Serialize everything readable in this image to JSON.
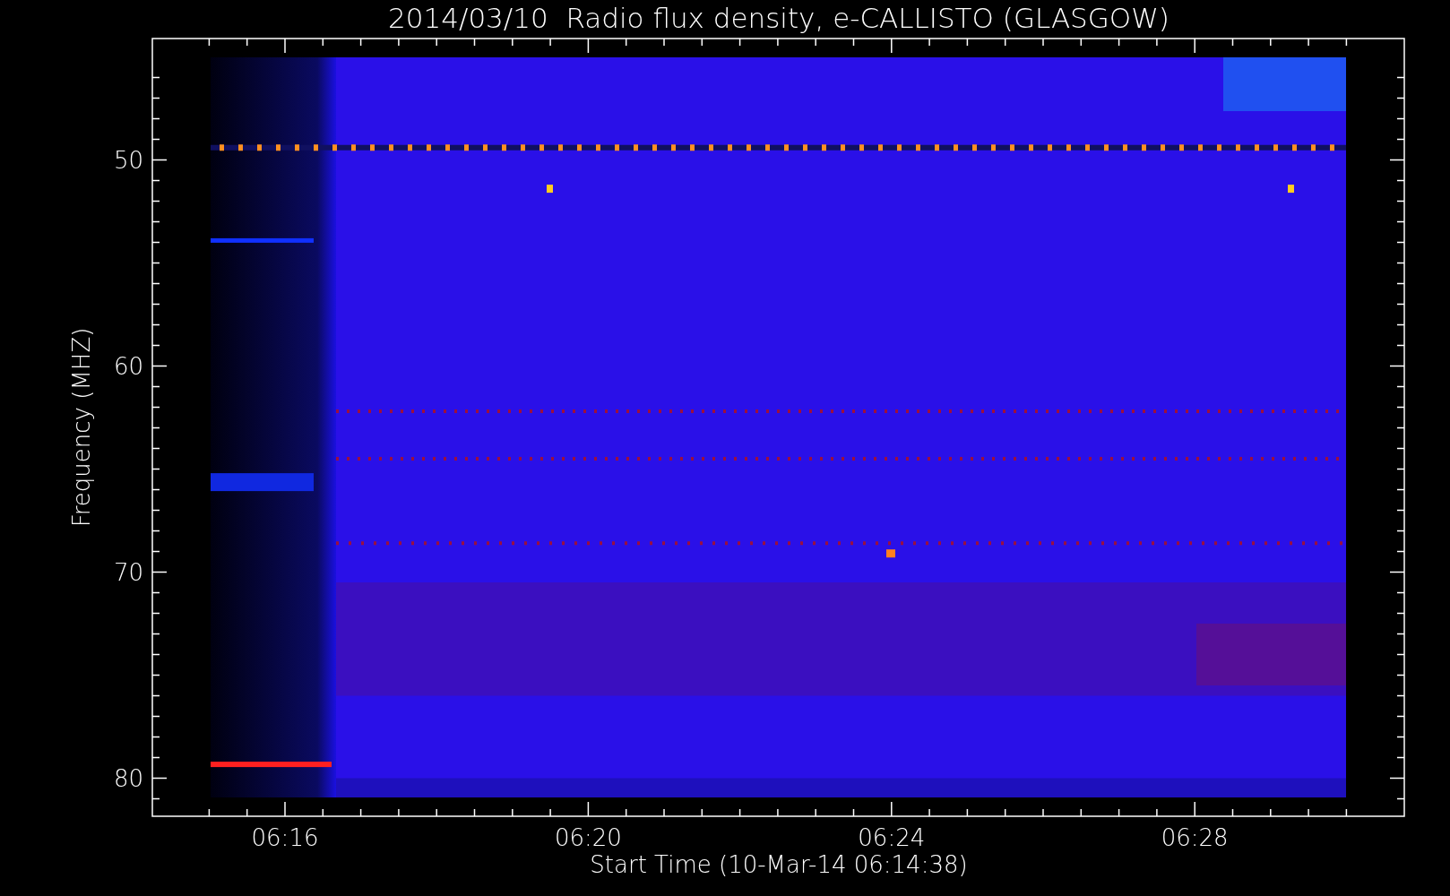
{
  "title": "2014/03/10  Radio flux density, e-CALLISTO (GLASGOW)",
  "ylabel": "Frequency (MHZ)",
  "xlabel": "Start Time (10-Mar-14 06:14:38)",
  "y_tick_labels": [
    "50",
    "60",
    "70",
    "80"
  ],
  "x_tick_labels": [
    "06:16",
    "06:20",
    "06:24",
    "06:28"
  ]
}
